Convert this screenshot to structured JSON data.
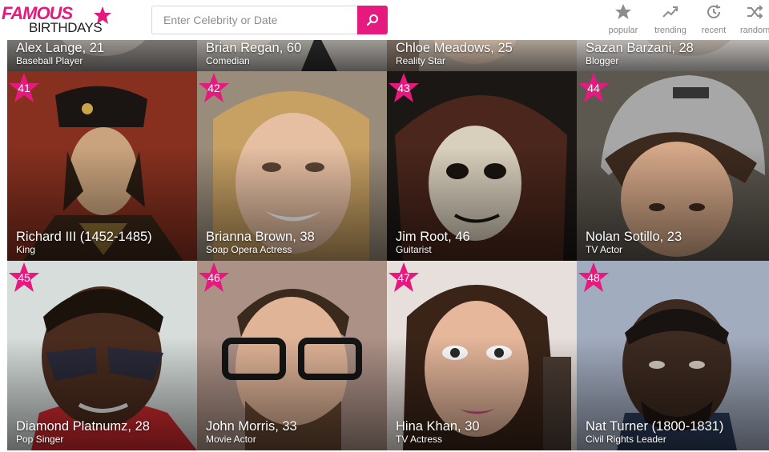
{
  "header": {
    "logo_top": "FAMOUS",
    "logo_bottom": "BIRTHDAYS",
    "search": {
      "placeholder": "Enter Celebrity or Date"
    },
    "nav": [
      {
        "label": "popular",
        "icon": "star-icon"
      },
      {
        "label": "trending",
        "icon": "trending-icon"
      },
      {
        "label": "recent",
        "icon": "clock-icon"
      },
      {
        "label": "random",
        "icon": "shuffle-icon"
      }
    ]
  },
  "colors": {
    "accent": "#e6197f"
  },
  "top_row": [
    {
      "name": "Alex Lange, 21",
      "job": "Baseball Player"
    },
    {
      "name": "Brian Regan, 60",
      "job": "Comedian"
    },
    {
      "name": "Chloe Meadows, 25",
      "job": "Reality Star"
    },
    {
      "name": "Sazan Barzani, 28",
      "job": "Blogger"
    }
  ],
  "cards": [
    {
      "rank": "41",
      "name": "Richard III (1452-1485)",
      "job": "King"
    },
    {
      "rank": "42",
      "name": "Brianna Brown, 38",
      "job": "Soap Opera Actress"
    },
    {
      "rank": "43",
      "name": "Jim Root, 46",
      "job": "Guitarist"
    },
    {
      "rank": "44",
      "name": "Nolan Sotillo, 23",
      "job": "TV Actor"
    },
    {
      "rank": "45",
      "name": "Diamond Platnumz, 28",
      "job": "Pop Singer"
    },
    {
      "rank": "46",
      "name": "John Morris, 33",
      "job": "Movie Actor"
    },
    {
      "rank": "47",
      "name": "Hina Khan, 30",
      "job": "TV Actress"
    },
    {
      "rank": "48",
      "name": "Nat Turner (1800-1831)",
      "job": "Civil Rights Leader"
    }
  ]
}
